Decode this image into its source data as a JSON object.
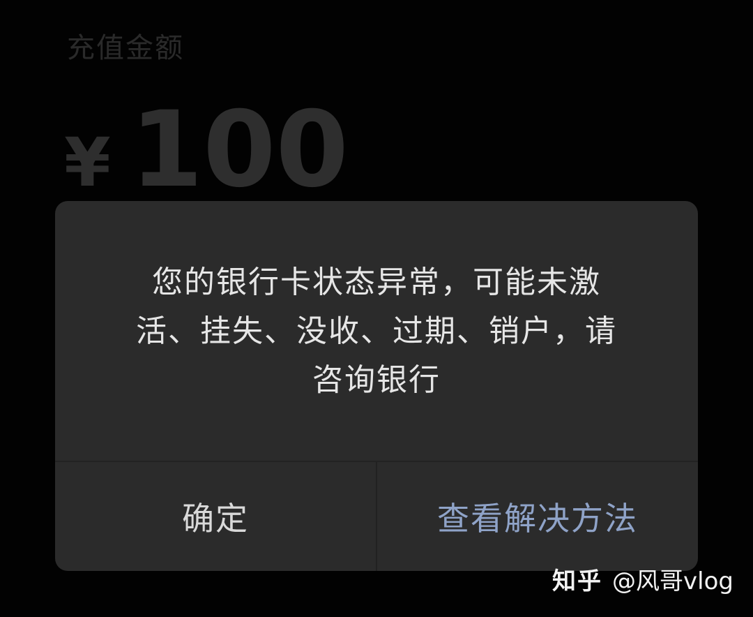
{
  "page": {
    "recharge_label": "充值金额",
    "currency_symbol": "¥",
    "amount": "100"
  },
  "dialog": {
    "message": "您的银行卡状态异常，可能未激\n活、挂失、没收、过期、销户，请\n咨询银行",
    "confirm_label": "确定",
    "solution_label": "查看解决方法",
    "solution_color": "#8fa3c8"
  },
  "watermark": {
    "brand": "知乎",
    "author": "@风哥vlog"
  }
}
